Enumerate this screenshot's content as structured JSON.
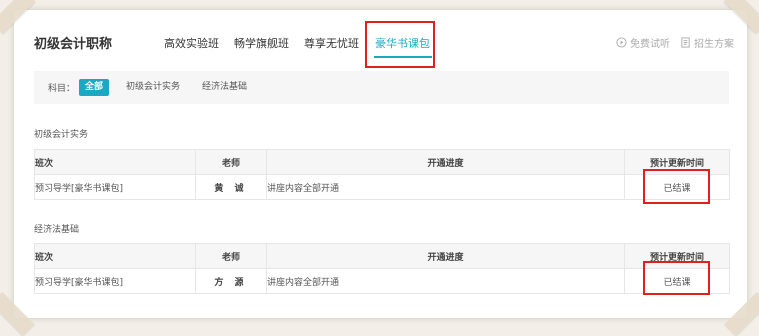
{
  "header": {
    "title": "初级会计职称",
    "tabs": [
      {
        "label": "高效实验班",
        "active": false
      },
      {
        "label": "畅学旗舰班",
        "active": false
      },
      {
        "label": "尊享无忧班",
        "active": false
      },
      {
        "label": "豪华书课包",
        "active": true
      }
    ],
    "links": [
      {
        "label": "免费试听",
        "icon": "play-circle-icon"
      },
      {
        "label": "招生方案",
        "icon": "document-icon"
      }
    ]
  },
  "filter": {
    "label": "科目：",
    "chips": [
      {
        "label": "全部",
        "active": true
      },
      {
        "label": "初级会计实务",
        "active": false
      },
      {
        "label": "经济法基础",
        "active": false
      }
    ]
  },
  "sections": [
    {
      "title": "初级会计实务",
      "columns": [
        "班次",
        "老师",
        "开通进度",
        "预计更新时间"
      ],
      "rows": [
        {
          "class": "预习导学[豪华书课包]",
          "teacher": "黄 诚",
          "progress": "讲座内容全部开通",
          "status": "已结课"
        }
      ]
    },
    {
      "title": "经济法基础",
      "columns": [
        "班次",
        "老师",
        "开通进度",
        "预计更新时间"
      ],
      "rows": [
        {
          "class": "预习导学[豪华书课包]",
          "teacher": "方 源",
          "progress": "讲座内容全部开通",
          "status": "已结课"
        }
      ]
    }
  ],
  "colors": {
    "accent": "#1aa9c4",
    "highlight": "#e02020",
    "background": "#f3efe8"
  }
}
